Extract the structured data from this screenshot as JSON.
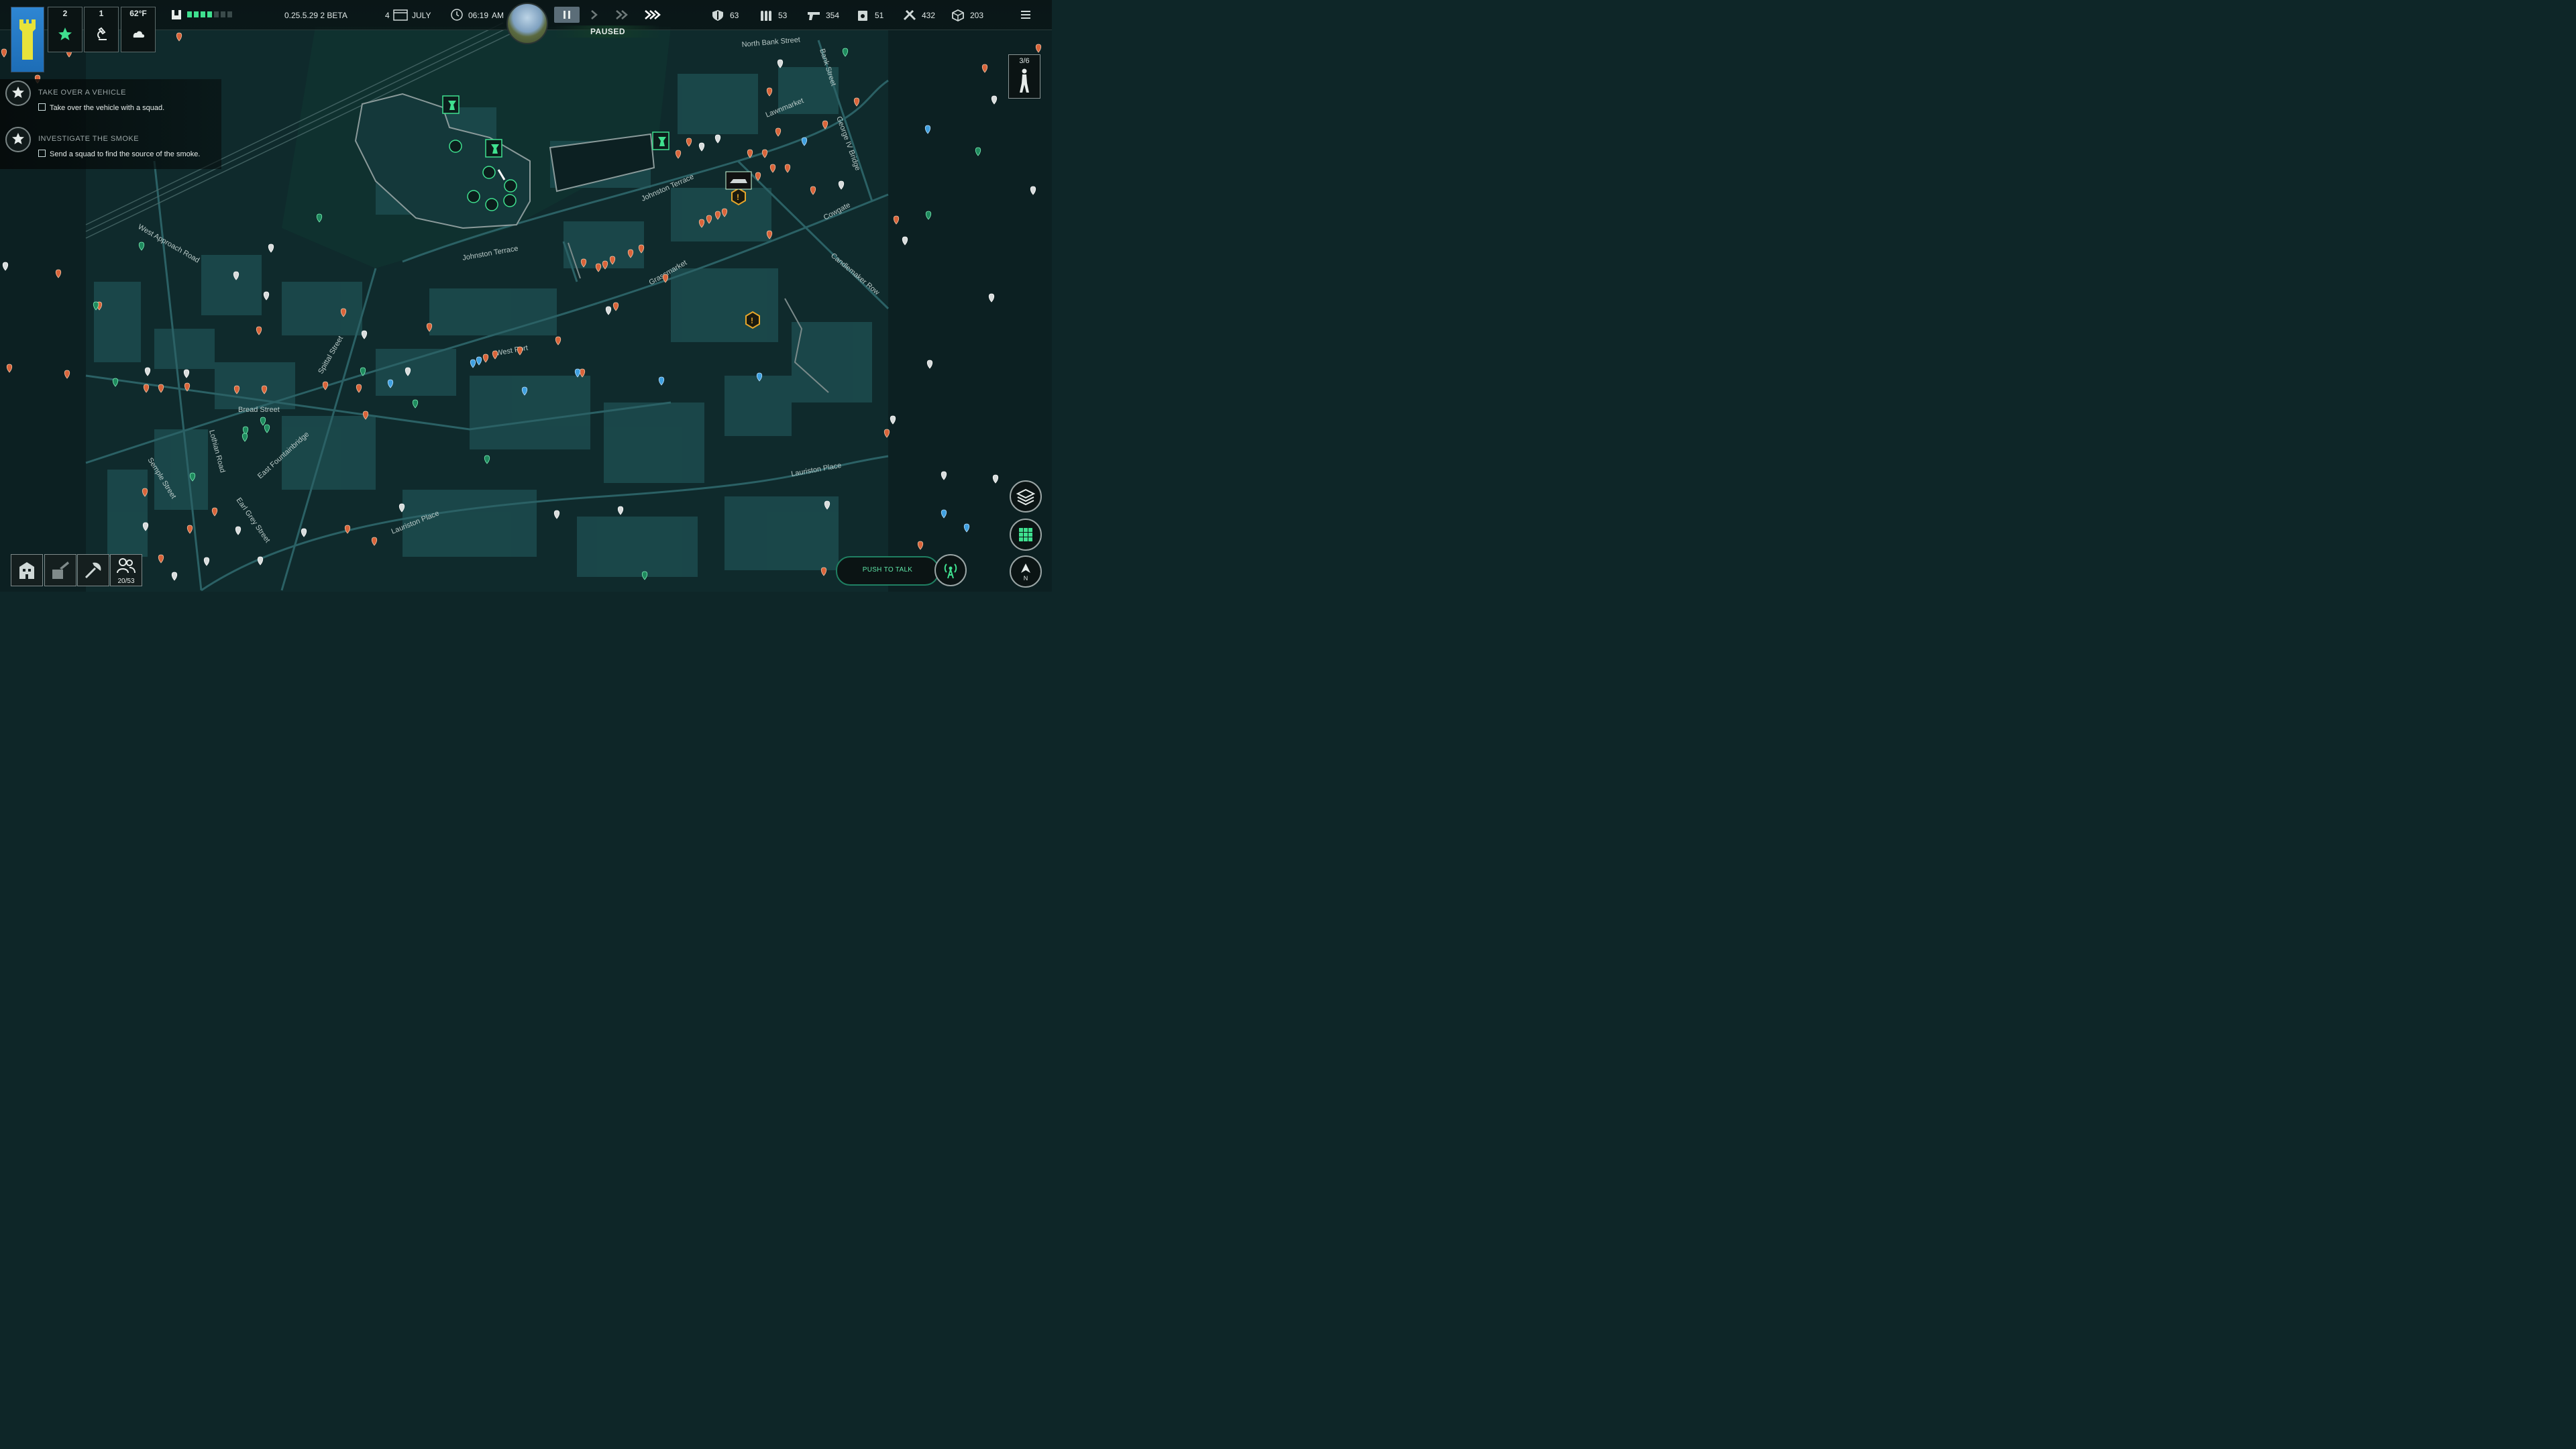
{
  "topbar": {
    "version": "0.25.5.29 2 BETA",
    "date_day": "4",
    "date_month": "JULY",
    "time": "06:19",
    "time_ampm": "AM",
    "paused_label": "PAUSED",
    "resources": [
      {
        "icon": "shield-icon",
        "value": "63"
      },
      {
        "icon": "ammo-icon",
        "value": "53"
      },
      {
        "icon": "pistol-icon",
        "value": "354"
      },
      {
        "icon": "fuel-can-icon",
        "value": "51"
      },
      {
        "icon": "tools-icon",
        "value": "432"
      },
      {
        "icon": "supplies-crate-icon",
        "value": "203"
      }
    ]
  },
  "status_cards": [
    {
      "value": "2",
      "icon": "star-icon"
    },
    {
      "value": "1",
      "icon": "research-icon"
    },
    {
      "value": "62°F",
      "icon": "cloud-icon"
    }
  ],
  "objectives": [
    {
      "title": "TAKE OVER A VEHICLE",
      "task": "Take over the vehicle with a squad."
    },
    {
      "title": "INVESTIGATE THE SMOKE",
      "task": "Send a squad to find the source of the smoke."
    }
  ],
  "bottom_buttons": {
    "population": "20/53"
  },
  "squad_card": {
    "count": "3/6"
  },
  "push_to_talk": "PUSH TO TALK",
  "compass_label": "N",
  "map": {
    "streets": [
      "North Bank Street",
      "Bank Street",
      "Lawnmarket",
      "George IV Bridge",
      "Johnston Terrace",
      "Cowgate",
      "Candlemaker Row",
      "West Approach Road",
      "Johnston Terrace",
      "Grassmarket",
      "Spittal Street",
      "West Port",
      "Bread Street",
      "Lothian Road",
      "East Fountainbridge",
      "Semple Street",
      "Earl Grey Street",
      "Lauriston Place",
      "Lauriston Place"
    ]
  },
  "colors": {
    "accent_green": "#3fe08f",
    "map_land": "#0f2a2c",
    "map_building": "#1c4a4d",
    "map_road": "#2b6165",
    "warning": "#e6a62a",
    "pin_orange": "#d9643a",
    "pin_white": "#d8dcdc",
    "pin_blue": "#3fa0e0"
  }
}
